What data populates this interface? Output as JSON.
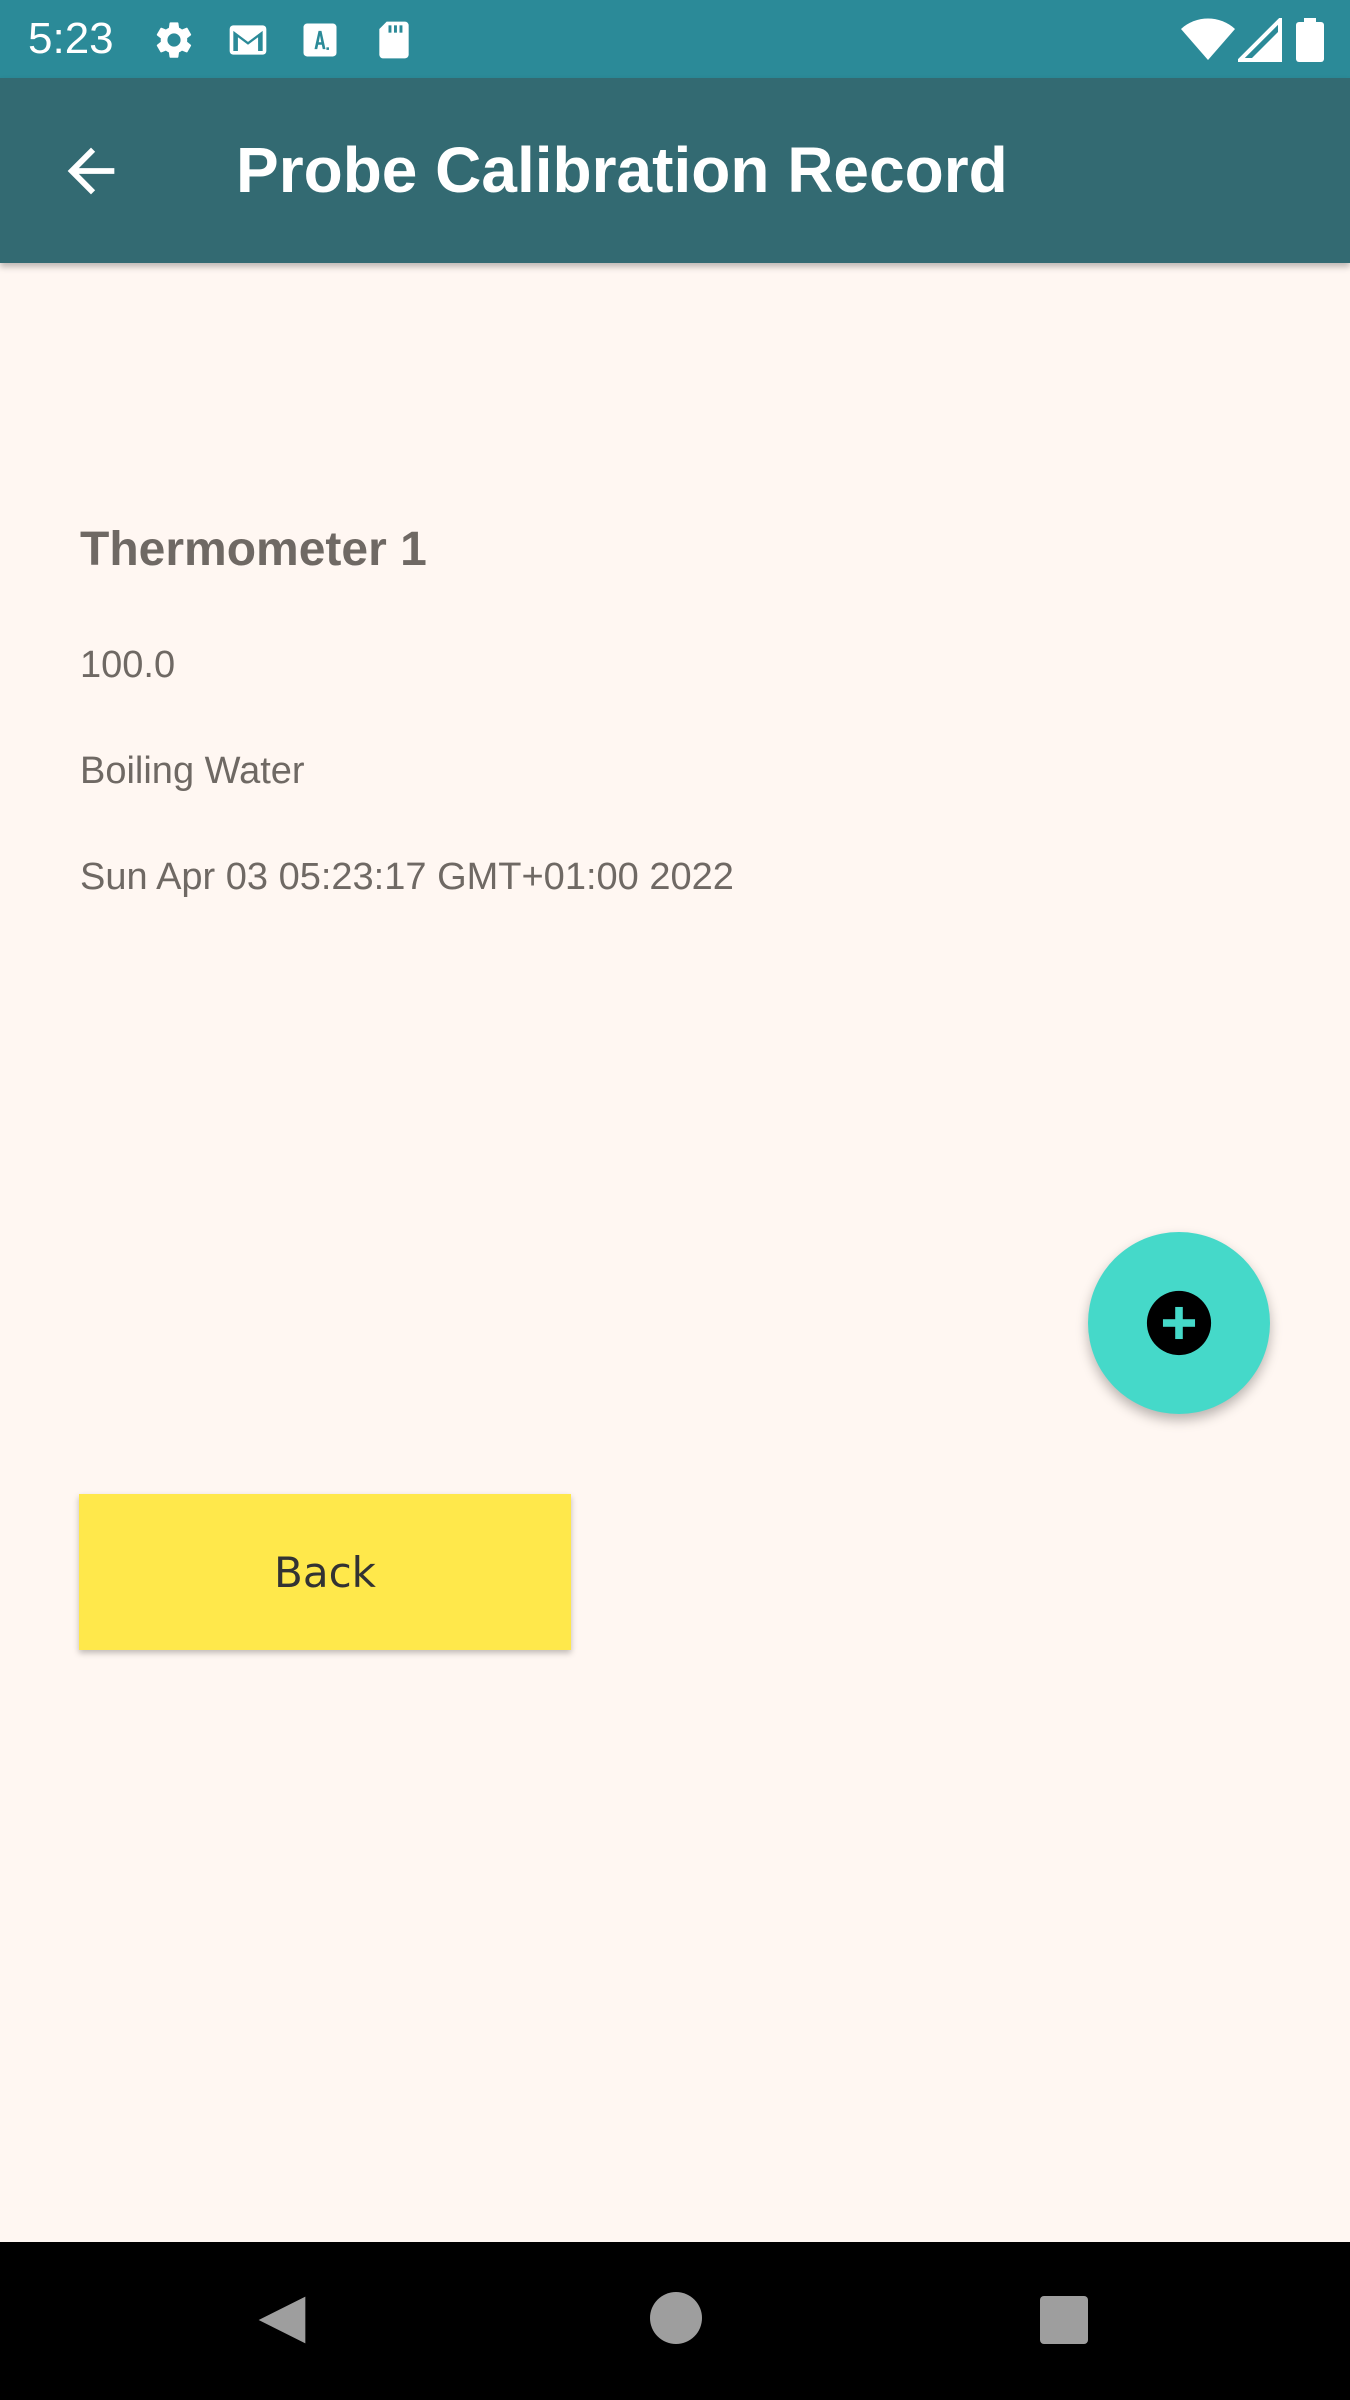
{
  "status_bar": {
    "time": "5:23",
    "left_icons": [
      "gear-icon",
      "gmail-icon",
      "a-box-icon",
      "sd-card-icon"
    ],
    "right_icons": [
      "wifi-icon",
      "signal-icon",
      "battery-icon"
    ],
    "color": "#2B8A98"
  },
  "app_bar": {
    "title": "Probe Calibration Record",
    "back_icon": "arrow-left-icon",
    "color": "#336A72"
  },
  "record": {
    "name": "Thermometer 1",
    "value": "100.0",
    "method": "Boiling Water",
    "timestamp": "Sun Apr 03 05:23:17 GMT+01:00 2022"
  },
  "fab": {
    "icon": "add-circle-icon",
    "color": "#45D9C9"
  },
  "back_button": {
    "label": "Back",
    "color": "#FFE84B"
  },
  "nav_bar": {
    "icons": [
      "back-triangle-icon",
      "home-circle-icon",
      "recents-square-icon"
    ]
  }
}
